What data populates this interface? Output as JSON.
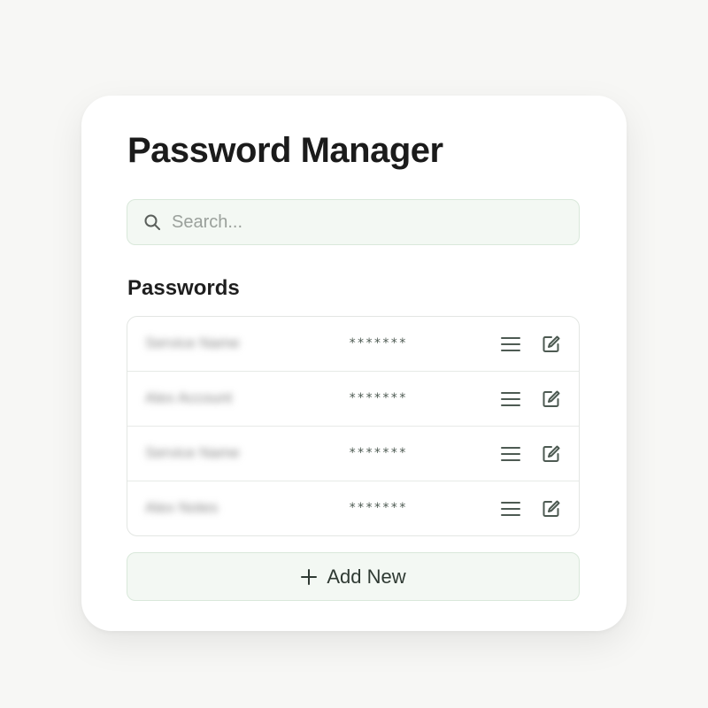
{
  "app": {
    "title": "Password Manager"
  },
  "search": {
    "placeholder": "Search...",
    "value": "",
    "icon": "search-icon"
  },
  "passwords": {
    "heading": "Passwords",
    "items": [
      {
        "name": "Service Name",
        "masked": "*******",
        "menu_icon": "menu-icon",
        "edit_icon": "edit-icon"
      },
      {
        "name": "Alex Account",
        "masked": "*******",
        "menu_icon": "menu-icon",
        "edit_icon": "edit-icon"
      },
      {
        "name": "Service Name",
        "masked": "*******",
        "menu_icon": "menu-icon",
        "edit_icon": "edit-icon"
      },
      {
        "name": "Alex Notes",
        "masked": "*******",
        "menu_icon": "menu-icon",
        "edit_icon": "edit-icon"
      }
    ]
  },
  "actions": {
    "add_label": "Add New",
    "add_icon": "plus-icon"
  },
  "colors": {
    "accent_bg": "#f3f8f3",
    "accent_border": "#d9e8da",
    "icon": "#4d5a52"
  }
}
